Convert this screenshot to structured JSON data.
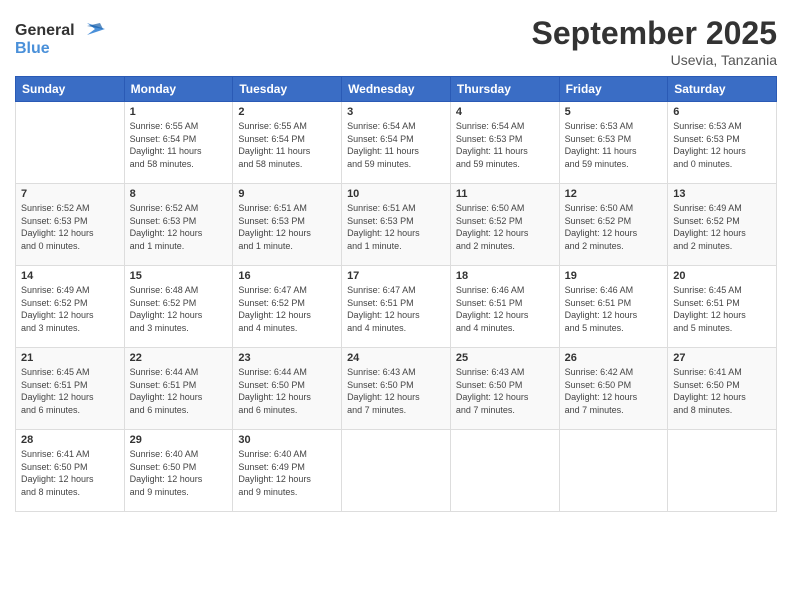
{
  "logo": {
    "general": "General",
    "blue": "Blue"
  },
  "header": {
    "title": "September 2025",
    "subtitle": "Usevia, Tanzania"
  },
  "weekdays": [
    "Sunday",
    "Monday",
    "Tuesday",
    "Wednesday",
    "Thursday",
    "Friday",
    "Saturday"
  ],
  "weeks": [
    [
      {
        "day": "",
        "info": ""
      },
      {
        "day": "1",
        "info": "Sunrise: 6:55 AM\nSunset: 6:54 PM\nDaylight: 11 hours\nand 58 minutes."
      },
      {
        "day": "2",
        "info": "Sunrise: 6:55 AM\nSunset: 6:54 PM\nDaylight: 11 hours\nand 58 minutes."
      },
      {
        "day": "3",
        "info": "Sunrise: 6:54 AM\nSunset: 6:54 PM\nDaylight: 11 hours\nand 59 minutes."
      },
      {
        "day": "4",
        "info": "Sunrise: 6:54 AM\nSunset: 6:53 PM\nDaylight: 11 hours\nand 59 minutes."
      },
      {
        "day": "5",
        "info": "Sunrise: 6:53 AM\nSunset: 6:53 PM\nDaylight: 11 hours\nand 59 minutes."
      },
      {
        "day": "6",
        "info": "Sunrise: 6:53 AM\nSunset: 6:53 PM\nDaylight: 12 hours\nand 0 minutes."
      }
    ],
    [
      {
        "day": "7",
        "info": "Sunrise: 6:52 AM\nSunset: 6:53 PM\nDaylight: 12 hours\nand 0 minutes."
      },
      {
        "day": "8",
        "info": "Sunrise: 6:52 AM\nSunset: 6:53 PM\nDaylight: 12 hours\nand 1 minute."
      },
      {
        "day": "9",
        "info": "Sunrise: 6:51 AM\nSunset: 6:53 PM\nDaylight: 12 hours\nand 1 minute."
      },
      {
        "day": "10",
        "info": "Sunrise: 6:51 AM\nSunset: 6:53 PM\nDaylight: 12 hours\nand 1 minute."
      },
      {
        "day": "11",
        "info": "Sunrise: 6:50 AM\nSunset: 6:52 PM\nDaylight: 12 hours\nand 2 minutes."
      },
      {
        "day": "12",
        "info": "Sunrise: 6:50 AM\nSunset: 6:52 PM\nDaylight: 12 hours\nand 2 minutes."
      },
      {
        "day": "13",
        "info": "Sunrise: 6:49 AM\nSunset: 6:52 PM\nDaylight: 12 hours\nand 2 minutes."
      }
    ],
    [
      {
        "day": "14",
        "info": "Sunrise: 6:49 AM\nSunset: 6:52 PM\nDaylight: 12 hours\nand 3 minutes."
      },
      {
        "day": "15",
        "info": "Sunrise: 6:48 AM\nSunset: 6:52 PM\nDaylight: 12 hours\nand 3 minutes."
      },
      {
        "day": "16",
        "info": "Sunrise: 6:47 AM\nSunset: 6:52 PM\nDaylight: 12 hours\nand 4 minutes."
      },
      {
        "day": "17",
        "info": "Sunrise: 6:47 AM\nSunset: 6:51 PM\nDaylight: 12 hours\nand 4 minutes."
      },
      {
        "day": "18",
        "info": "Sunrise: 6:46 AM\nSunset: 6:51 PM\nDaylight: 12 hours\nand 4 minutes."
      },
      {
        "day": "19",
        "info": "Sunrise: 6:46 AM\nSunset: 6:51 PM\nDaylight: 12 hours\nand 5 minutes."
      },
      {
        "day": "20",
        "info": "Sunrise: 6:45 AM\nSunset: 6:51 PM\nDaylight: 12 hours\nand 5 minutes."
      }
    ],
    [
      {
        "day": "21",
        "info": "Sunrise: 6:45 AM\nSunset: 6:51 PM\nDaylight: 12 hours\nand 6 minutes."
      },
      {
        "day": "22",
        "info": "Sunrise: 6:44 AM\nSunset: 6:51 PM\nDaylight: 12 hours\nand 6 minutes."
      },
      {
        "day": "23",
        "info": "Sunrise: 6:44 AM\nSunset: 6:50 PM\nDaylight: 12 hours\nand 6 minutes."
      },
      {
        "day": "24",
        "info": "Sunrise: 6:43 AM\nSunset: 6:50 PM\nDaylight: 12 hours\nand 7 minutes."
      },
      {
        "day": "25",
        "info": "Sunrise: 6:43 AM\nSunset: 6:50 PM\nDaylight: 12 hours\nand 7 minutes."
      },
      {
        "day": "26",
        "info": "Sunrise: 6:42 AM\nSunset: 6:50 PM\nDaylight: 12 hours\nand 7 minutes."
      },
      {
        "day": "27",
        "info": "Sunrise: 6:41 AM\nSunset: 6:50 PM\nDaylight: 12 hours\nand 8 minutes."
      }
    ],
    [
      {
        "day": "28",
        "info": "Sunrise: 6:41 AM\nSunset: 6:50 PM\nDaylight: 12 hours\nand 8 minutes."
      },
      {
        "day": "29",
        "info": "Sunrise: 6:40 AM\nSunset: 6:50 PM\nDaylight: 12 hours\nand 9 minutes."
      },
      {
        "day": "30",
        "info": "Sunrise: 6:40 AM\nSunset: 6:49 PM\nDaylight: 12 hours\nand 9 minutes."
      },
      {
        "day": "",
        "info": ""
      },
      {
        "day": "",
        "info": ""
      },
      {
        "day": "",
        "info": ""
      },
      {
        "day": "",
        "info": ""
      }
    ]
  ]
}
